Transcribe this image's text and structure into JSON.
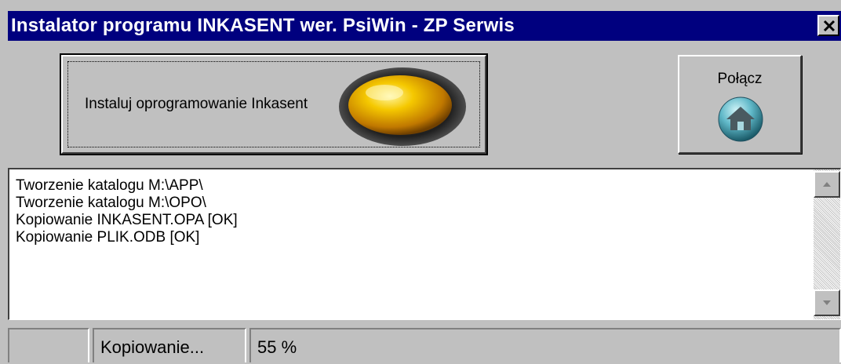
{
  "window": {
    "title": "Instalator programu INKASENT wer. PsiWin  - ZP Serwis",
    "close_icon": "close-x"
  },
  "toolbar": {
    "install_label": "Instaluj oprogramowanie Inkasent",
    "install_icon": "yellow-oval-button",
    "connect_label": "Połącz",
    "connect_icon": "home-icon"
  },
  "log": {
    "lines": [
      "Tworzenie katalogu M:\\APP\\",
      "Tworzenie katalogu M:\\OPO\\",
      "Kopiowanie INKASENT.OPA [OK]",
      "Kopiowanie PLIK.ODB [OK]"
    ]
  },
  "status": {
    "panel1": "",
    "panel2": "Kopiowanie...",
    "panel3": "55 %"
  },
  "colors": {
    "titlebar": "#00007f",
    "face": "#c0c0c0",
    "oval": "#f0b000",
    "home": "#40a0b0"
  }
}
